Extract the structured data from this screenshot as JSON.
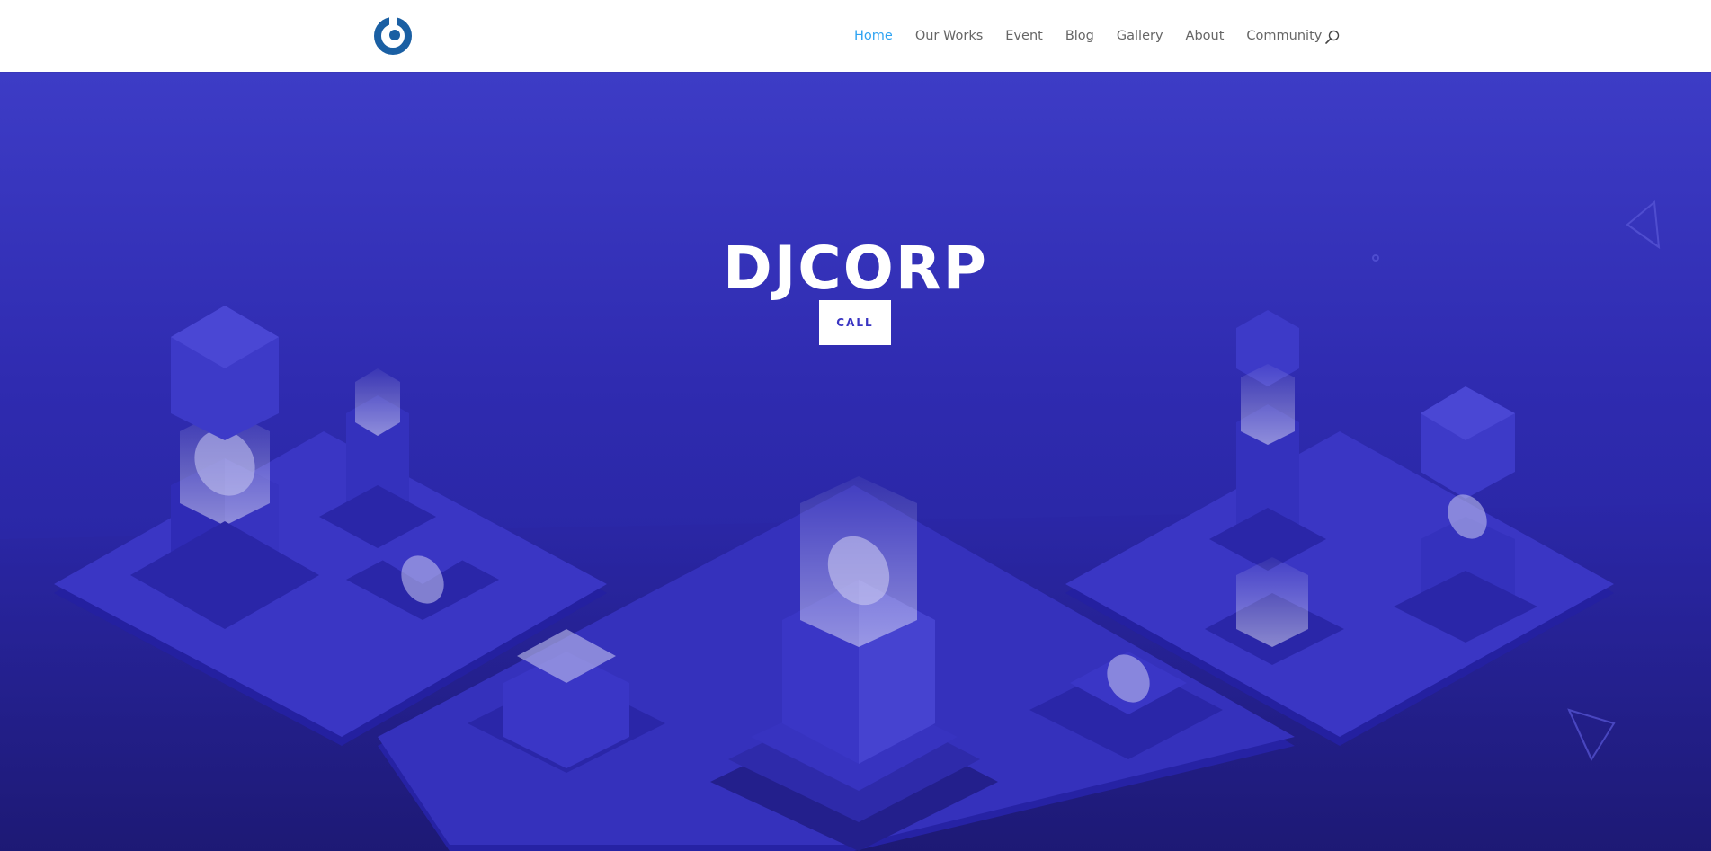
{
  "header": {
    "logo_icon": "circle-logo-icon",
    "nav_items": [
      {
        "label": "Home",
        "active": true
      },
      {
        "label": "Our Works",
        "active": false
      },
      {
        "label": "Event",
        "active": false
      },
      {
        "label": "Blog",
        "active": false
      },
      {
        "label": "Gallery",
        "active": false
      },
      {
        "label": "About",
        "active": false
      },
      {
        "label": "Community",
        "active": false
      }
    ],
    "search_icon": "search-icon"
  },
  "hero": {
    "title": "DJCORP",
    "cta_label": "CALL"
  },
  "colors": {
    "nav_active": "#2ea3f2",
    "nav_text": "#666666",
    "logo": "#1a5fa3",
    "hero_top": "#3d3cc6",
    "hero_bottom": "#242091",
    "cta_text": "#3a35c2"
  }
}
